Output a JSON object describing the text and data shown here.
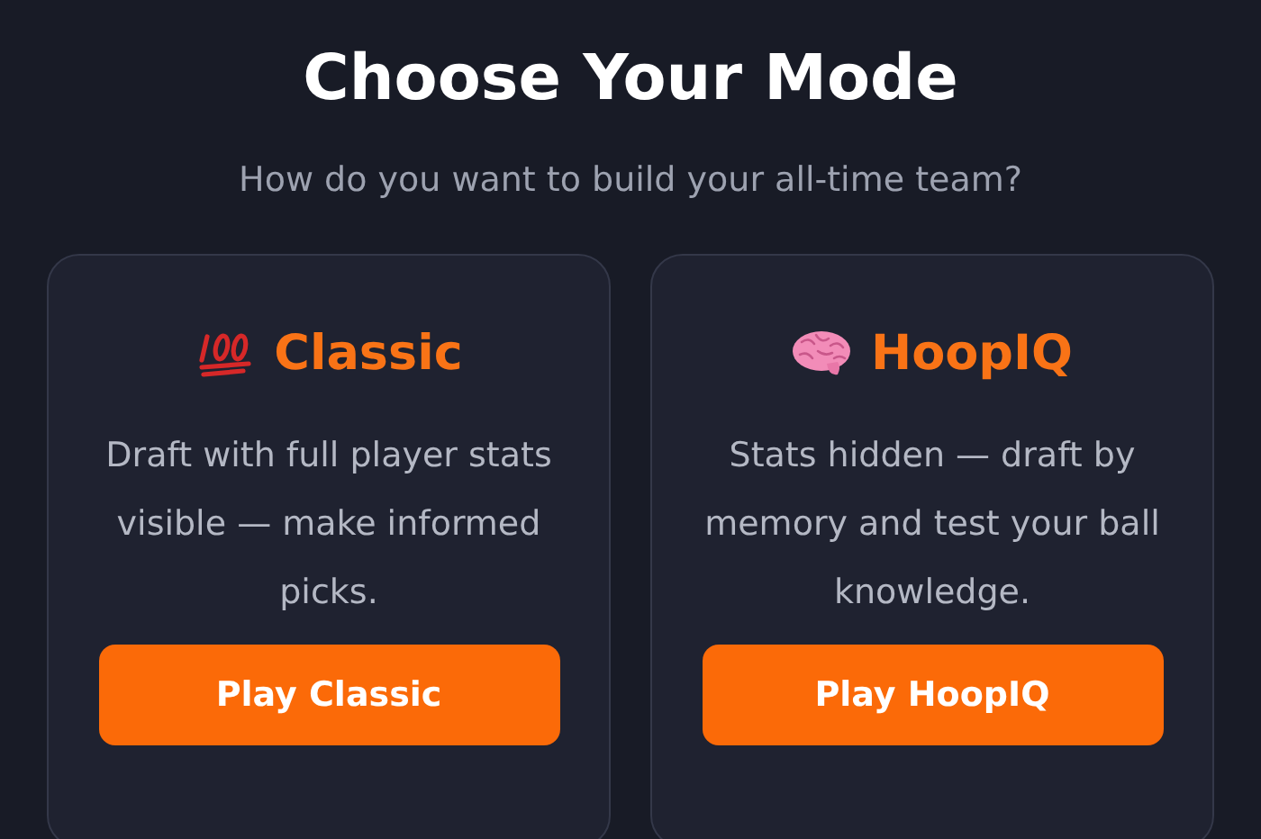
{
  "title": "Choose Your Mode",
  "subtitle": "How do you want to build your all-time team?",
  "modes": [
    {
      "kind": "hundred",
      "name": "Classic",
      "description": "Draft with full player stats visible — make informed picks.",
      "button": "Play Classic"
    },
    {
      "kind": "brain",
      "name": "HoopIQ",
      "description": "Stats hidden — draft by memory and test your ball knowledge.",
      "button": "Play HoopIQ"
    }
  ]
}
